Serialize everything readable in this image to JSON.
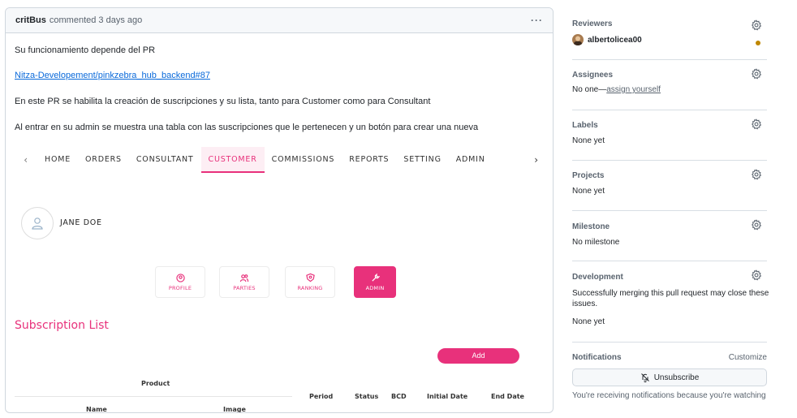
{
  "comment": {
    "author": "critBus",
    "meta": "commented 3 days ago",
    "more_label": "···",
    "paragraph1": "Su funcionamiento depende del PR",
    "link": "Nitza-Developement/pinkzebra_hub_backend#87",
    "paragraph3": "En este PR se habilita la creación de suscripciones y su lista, tanto para Customer como para Consultant",
    "paragraph4": "Al entrar en su admin se muestra una tabla con las suscripciones que le pertenecen y un botón para crear una nueva"
  },
  "app_screenshot": {
    "nav": {
      "prev": "‹",
      "next": "›",
      "items": [
        "HOME",
        "ORDERS",
        "CONSULTANT",
        "CUSTOMER",
        "COMMISSIONS",
        "REPORTS",
        "SETTING",
        "ADMIN"
      ],
      "active": "CUSTOMER"
    },
    "user_name": "JANE DOE",
    "tiles": [
      {
        "label": "PROFILE",
        "icon": "profile-icon"
      },
      {
        "label": "PARTIES",
        "icon": "parties-icon"
      },
      {
        "label": "RANKING",
        "icon": "ranking-icon"
      },
      {
        "label": "ADMIN",
        "icon": "wrench-icon"
      }
    ],
    "section_title": "Subscription List",
    "add_label": "Add",
    "table_headers": {
      "product": "Product",
      "name": "Name",
      "image": "Image",
      "period": "Period",
      "status": "Status",
      "bcd": "BCD",
      "initial_date": "Initial Date",
      "end_date": "End Date"
    },
    "accent_color": "#e8317b"
  },
  "sidebar": {
    "reviewers": {
      "title": "Reviewers",
      "name": "albertolicea00",
      "status_color": "#bf8700"
    },
    "assignees": {
      "title": "Assignees",
      "prefix": "No one—",
      "link": "assign yourself"
    },
    "labels": {
      "title": "Labels",
      "value": "None yet"
    },
    "projects": {
      "title": "Projects",
      "value": "None yet"
    },
    "milestone": {
      "title": "Milestone",
      "value": "No milestone"
    },
    "development": {
      "title": "Development",
      "text1": "Successfully merging this pull request may close these",
      "text2": "issues.",
      "value": "None yet"
    },
    "notifications": {
      "title": "Notifications",
      "customize": "Customize",
      "button": "Unsubscribe",
      "note": "You're receiving notifications because you're watching"
    }
  }
}
